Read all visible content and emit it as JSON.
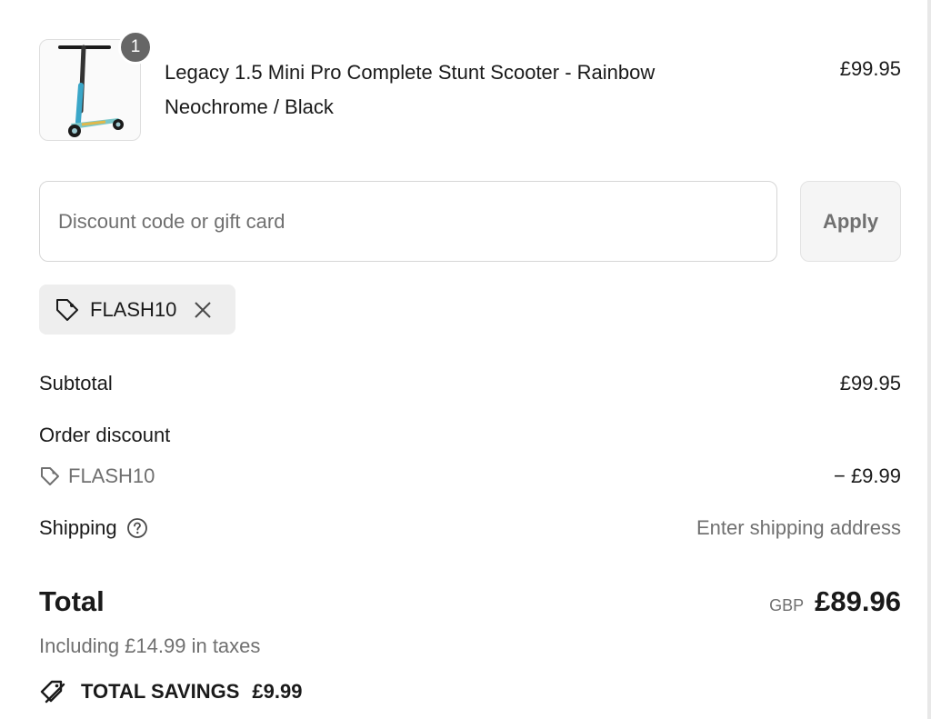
{
  "product": {
    "title": "Legacy 1.5 Mini Pro Complete Stunt Scooter - Rainbow Neochrome / Black",
    "price": "£99.95",
    "quantity": "1",
    "image_icon": "stunt-scooter-image"
  },
  "discount": {
    "placeholder": "Discount code or gift card",
    "value": "",
    "apply_label": "Apply",
    "applied_code": "FLASH10"
  },
  "summary": {
    "subtotal_label": "Subtotal",
    "subtotal_value": "£99.95",
    "order_discount_label": "Order discount",
    "discount_code": "FLASH10",
    "discount_value": "− £9.99",
    "shipping_label": "Shipping",
    "shipping_value": "Enter shipping address",
    "total_label": "Total",
    "currency": "GBP",
    "total_value": "£89.96",
    "taxes_note": "Including £14.99 in taxes",
    "savings_label": "TOTAL SAVINGS",
    "savings_value": "£9.99"
  },
  "colors": {
    "text": "#1a1a1a",
    "muted": "#707070",
    "badge": "#666666",
    "chip_bg": "#eeeeee"
  }
}
